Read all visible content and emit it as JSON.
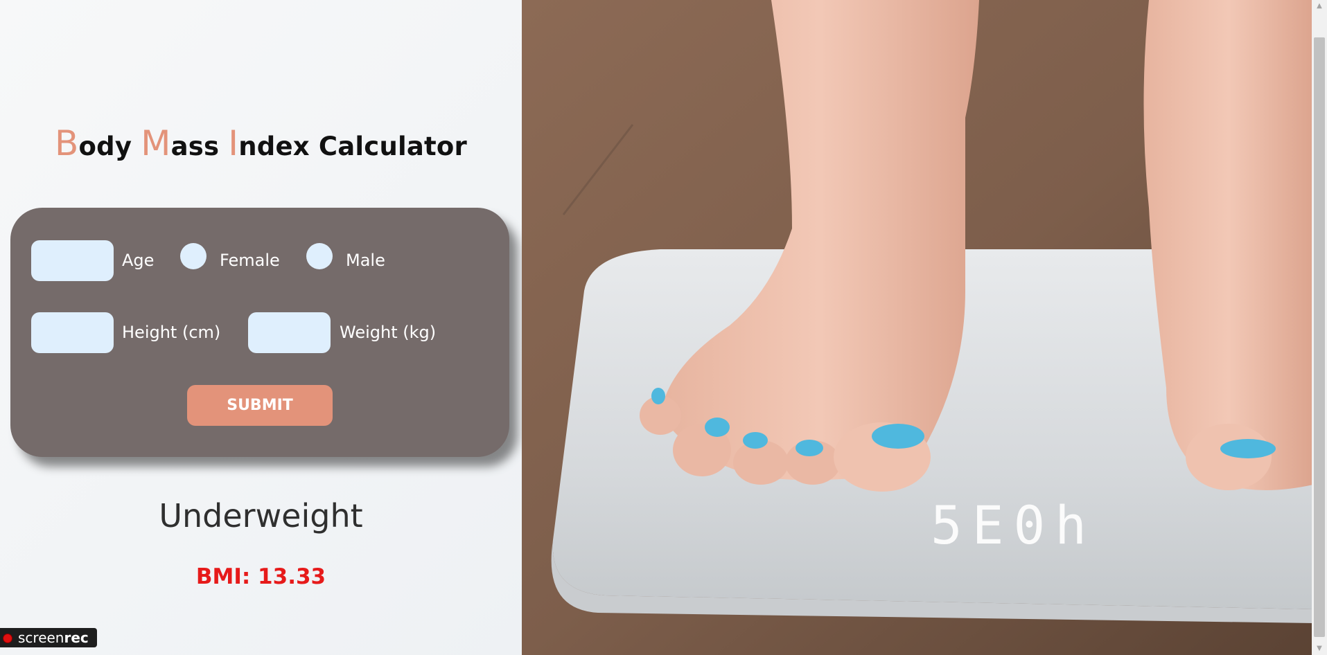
{
  "title": {
    "word1_initial": "B",
    "word1_rest": "ody ",
    "word2_initial": "M",
    "word2_rest": "ass ",
    "word3_initial": "I",
    "word3_rest": "ndex ",
    "word4": "Calculator"
  },
  "form": {
    "age_label": "Age",
    "female_label": "Female",
    "male_label": "Male",
    "height_label": "Height (cm)",
    "weight_label": "Weight (kg)",
    "submit_label": "SUBMIT"
  },
  "result": {
    "category": "Underweight",
    "bmi_text": "BMI: 13.33"
  },
  "recorder": {
    "brand_a": "screen",
    "brand_b": "rec"
  },
  "photo": {
    "scale_display": "5E0h"
  },
  "colors": {
    "accent": "#e3937a",
    "card": "#756b6a",
    "input": "#dfeffd",
    "bmi": "#e61a1a"
  }
}
